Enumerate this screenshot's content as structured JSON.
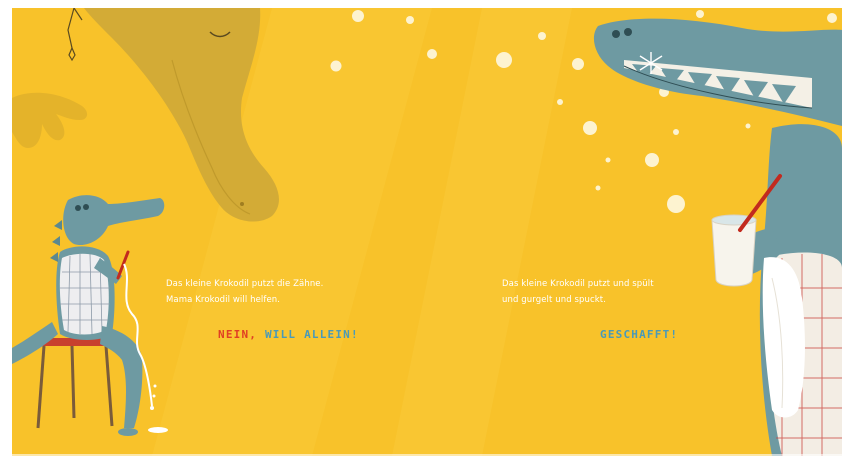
{
  "left_page": {
    "line1": "Das kleine Krokodil putzt die Zähne.",
    "line2": "Mama Krokodil will helfen.",
    "shout_red": "NEIN,",
    "shout_blue": "WILL ALLEIN!"
  },
  "right_page": {
    "line1": "Das kleine Krokodil putzt und spült",
    "line2": "und gurgelt und spuckt.",
    "shout": "GESCHAFFT!"
  },
  "colors": {
    "background": "#f8c22a",
    "crocodile": "#6e9aa2",
    "accent_red": "#e03f24",
    "accent_blue": "#4a9ab8"
  }
}
